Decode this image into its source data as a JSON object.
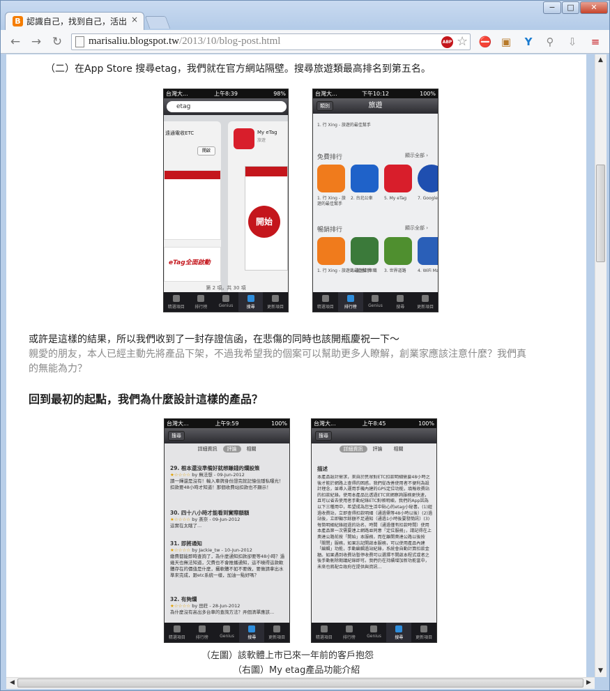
{
  "browser": {
    "tab_title": "認識自己，找到自己，活出",
    "tab_close": "×",
    "url_host": "marisaliu.blogspot.tw",
    "url_path": "/2013/10/blog-post.html",
    "abp": "ABP",
    "window_buttons": {
      "minimize": "−",
      "maximize": "□",
      "close": "✕"
    }
  },
  "article": {
    "line1": "（二）在App Store 搜尋etag，我們就在官方網站隔壁。搜尋旅遊類最高排名到第五名。",
    "line2": "或許是這樣的結果，所以我們收到了一封存證信函，在悲傷的同時也該開瓶慶祝一下～",
    "line3": "親愛的朋友，本人已經主動先將產品下架，不過我希望我的個案可以幫助更多人瞭解，創業家應該注意什麼？我們真",
    "line4": "的無能為力？",
    "heading": "回到最初的起點，我們為什麼設計這樣的產品？",
    "caption1": "（左圖）該軟體上市已來一年前的客戶抱怨",
    "caption2": "（右圖）My etag產品功能介紹"
  },
  "shots": {
    "s1": {
      "carrier": "台灣大...",
      "time": "上午8:39",
      "battery": "98%",
      "search": "etag",
      "card1_title": "遠通電收ETC",
      "card1_btn": "開啟",
      "card2_title": "My eTag",
      "card2_sub": "旅遊",
      "pager": "第 2 項，共 30 項",
      "logo": "MyeTag",
      "start": "開始",
      "promo": "eTag全面啟動"
    },
    "s2": {
      "carrier": "台灣大...",
      "time": "下午10:12",
      "battery": "100%",
      "title": "旅遊",
      "left_btn": "類別",
      "free": "免費排行",
      "paid": "暢銷排行",
      "showall": "顯示全部 ›",
      "free_apps": [
        "1. 行 Xing - 旅遊的最佳幫手",
        "2. 台北公車",
        "3. 台北好行",
        "5. My eTag",
        "7. Google Earth"
      ],
      "paid_apps": [
        "1. 行 Xing - 旅遊的最佳幫手",
        "2. 當地計車職",
        "3. 世界道路",
        "4. WiFi Map Pro - Offline"
      ]
    },
    "s3": {
      "carrier": "台灣大...",
      "time": "上午9:59",
      "battery": "100%",
      "back": "搜尋",
      "seg": [
        "詳細資訊",
        "評論",
        "相關"
      ],
      "reviews": [
        {
          "title": "29. 根本還沒準備好就想賺錢的爛設策",
          "by": "by 無法想 - 09-Jun-2012",
          "body": "讀一輝還是沒有！輸入車牌身份證完就記憶住隱私曝光！扣款要48小時才知道！那個收費站扣款也不顯示！"
        },
        {
          "title": "30. 四十八小時才能看到實際額額",
          "by": "by 蒸奈 - 09-Jun-2012",
          "body": "這實在太瞎了..."
        },
        {
          "title": "31. 即將通知",
          "by": "by Jackie_tw - 10-Jun-2012",
          "body": "繳費都能即時查詢了，為什麼通知扣款卻要等48小時？過幾天也無法知道，欠費也不會推播通知，這不曉得這款軟體存在的價值是什麼，攝軟體不如不要做，要做請拿出水準來完成，跟etc系統一樣，加油一點好嗎？"
        },
        {
          "title": "32. 有夠爛",
          "by": "by 田莊 - 28-Jun-2012",
          "body": "為什麼沒有高出多台車的查詢方法？弄個清單應該..."
        }
      ]
    },
    "s4": {
      "carrier": "台灣大...",
      "time": "上午8:45",
      "battery": "100%",
      "back": "搜尋",
      "seg": [
        "詳細資訊",
        "評論",
        "相關"
      ],
      "desc_title": "描述",
      "desc": "本產品設計需求，來自於民眾對ETC扣款明細需要48小時之後才能於網路上查得的困惑。我們從改善使用者不便利為設計理念，並導入運用手機內建的GPS定位功能，填報收費站的扣款紀錄。使用本產品比透過ETC官網察詢服務更快速，且可以省去使用者手動紀錄ETC對帳明細，我們的App因為以下三種用中，希望成為您生活中貼心的etag小秘書。(1)經過收費站，立即查得扣款明細（通過需等48小時以後）(2)過站後，立即顯示餘額不足通知（通過1小時後要發簡訊）(3)每筒明細紀錄經過的站名、時間（通過僅有扣款時間）使用本產品第一次需要連上網路並同意「定位服務」，請記得在上奧達公路前按「開始」本服務，而在離開奧達公路以後按「關閉」服務，如果忘記開啟本服務，可以使用產品內建「編輯」功能，手動編輯過站紀錄，系統會自動計算扣款金額。如果遇到收費站暫停收費可以選擇不開啟本程式或者之後手動刪除期議紀錄即可。我們仍在持續增加新功能當中，未來也將配合政府在提供與資訊..."
    },
    "tabbar": [
      "精選項目",
      "排行榜",
      "Genius",
      "搜尋",
      "更新項目"
    ]
  }
}
